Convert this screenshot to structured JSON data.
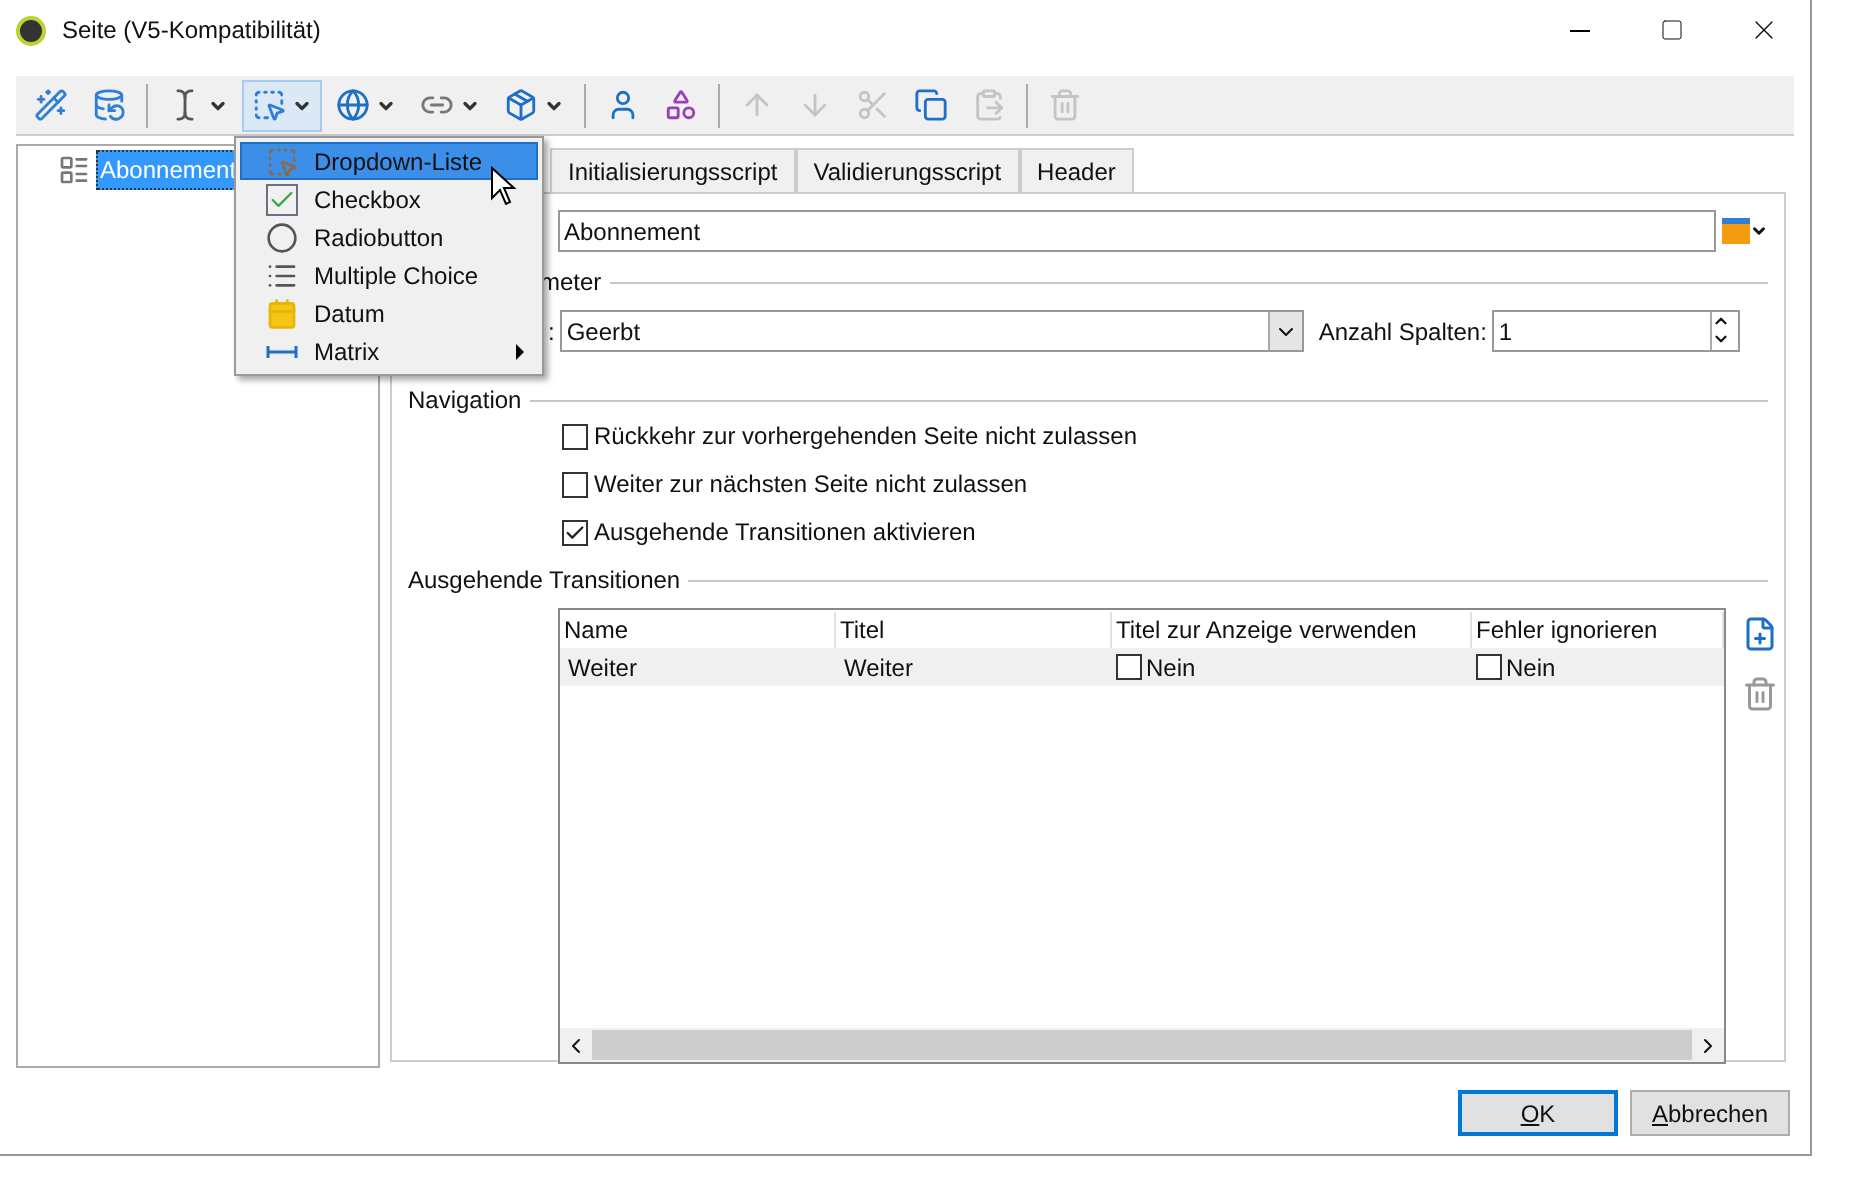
{
  "window": {
    "title": "Seite (V5-Kompatibilität)"
  },
  "toolbar": [
    {
      "disabled": false,
      "dropdown": false,
      "pressed": false
    },
    {
      "disabled": false,
      "dropdown": false,
      "pressed": false
    },
    {
      "disabled": false,
      "dropdown": true,
      "pressed": false
    },
    {
      "disabled": false,
      "dropdown": true,
      "pressed": true
    },
    {
      "disabled": false,
      "dropdown": true,
      "pressed": false
    },
    {
      "disabled": false,
      "dropdown": true,
      "pressed": false
    },
    {
      "disabled": false,
      "dropdown": true,
      "pressed": false
    },
    {
      "disabled": false,
      "dropdown": false,
      "pressed": false
    },
    {
      "disabled": false,
      "dropdown": false,
      "pressed": false
    },
    {
      "disabled": true,
      "dropdown": false,
      "pressed": false
    },
    {
      "disabled": true,
      "dropdown": false,
      "pressed": false
    },
    {
      "disabled": true,
      "dropdown": false,
      "pressed": false
    },
    {
      "disabled": false,
      "dropdown": false,
      "pressed": false
    },
    {
      "disabled": true,
      "dropdown": false,
      "pressed": false
    },
    {
      "disabled": true,
      "dropdown": false,
      "pressed": false
    }
  ],
  "tree": [
    {
      "label": "Abonnement",
      "selected": true
    }
  ],
  "menu": [
    {
      "label": "Dropdown-Liste",
      "kind": "dropdown",
      "selected": true,
      "submenu": false
    },
    {
      "label": "Checkbox",
      "kind": "checkbox",
      "selected": false,
      "submenu": false
    },
    {
      "label": "Radiobutton",
      "kind": "radio",
      "selected": false,
      "submenu": false
    },
    {
      "label": "Multiple Choice",
      "kind": "multiple",
      "selected": false,
      "submenu": false
    },
    {
      "label": "Datum",
      "kind": "date",
      "selected": false,
      "submenu": false
    },
    {
      "label": "Matrix",
      "kind": "matrix",
      "selected": false,
      "submenu": true
    }
  ],
  "tabs": [
    {
      "label": "Initialisierungsscript",
      "selected": false
    },
    {
      "label": "Validierungsscript",
      "selected": false
    },
    {
      "label": "Header",
      "selected": false
    }
  ],
  "label_field": {
    "value": "Abonnement"
  },
  "parameters": {
    "legend": "meter",
    "layout_label": ":",
    "layout_value": "Geerbt",
    "columns_label": "Anzahl Spalten:",
    "columns_value": "1"
  },
  "navigation": {
    "legend": "Navigation",
    "options": [
      {
        "label": "Rückkehr zur vorhergehenden Seite nicht zulassen",
        "checked": false
      },
      {
        "label": "Weiter zur nächsten Seite nicht zulassen",
        "checked": false
      },
      {
        "label": "Ausgehende Transitionen aktivieren",
        "checked": true
      }
    ]
  },
  "transitions": {
    "legend": "Ausgehende Transitionen",
    "columns": [
      "Name",
      "Titel",
      "Titel zur Anzeige verwenden",
      "Fehler ignorieren"
    ],
    "rows": [
      {
        "name": "Weiter",
        "title": "Weiter",
        "use_title": {
          "checked": false,
          "label": "Nein"
        },
        "ignore_errors": {
          "checked": false,
          "label": "Nein"
        },
        "selected": true
      }
    ]
  },
  "buttons": [
    {
      "label": "OK",
      "default": true
    },
    {
      "label": "Abbrechen",
      "default": false
    }
  ]
}
